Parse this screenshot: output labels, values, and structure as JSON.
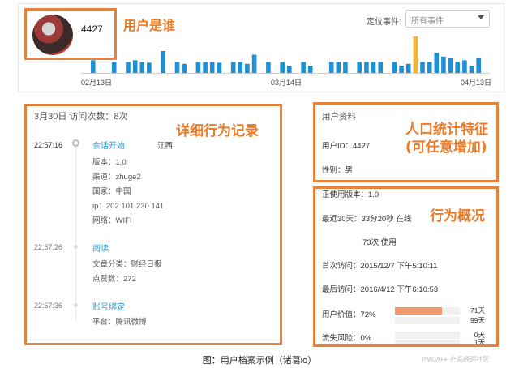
{
  "header": {
    "user_id": "4427",
    "filter_label": "定位事件:",
    "filter_value": "所有事件"
  },
  "timeline": {
    "dates": [
      "02月13日",
      "03月14日",
      "04月13日"
    ],
    "values": [
      0.35,
      0,
      0,
      0.3,
      0,
      0.3,
      0.35,
      0.3,
      0.28,
      0,
      0.6,
      0,
      0.3,
      0.25,
      0,
      0.3,
      0.3,
      0.3,
      0.28,
      0,
      0.3,
      0.3,
      0.25,
      0.5,
      0,
      0.3,
      0,
      0.3,
      0.2,
      0,
      0.3,
      0.2,
      0,
      0,
      0.3,
      0.3,
      0.3,
      0,
      0.3,
      0.3,
      0.3,
      0.3,
      0,
      0.3,
      0.2,
      0.25,
      1.0,
      0.3,
      0.3,
      0.55,
      0.45,
      0.4,
      0.3,
      0.35,
      0.2,
      0.4
    ],
    "colors": {
      "default": "#1e90d6",
      "highlight": "#f2b43a"
    },
    "highlight_index": 46
  },
  "detail": {
    "header": "3月30日  访问次数：8次",
    "events": [
      {
        "time": "22:57:16",
        "title": "会话开始",
        "extra": "江西",
        "lines": [
          "版本：1.0",
          "渠道：zhuge2",
          "国家：中国",
          "ip：202.101.230.141",
          "网络：WIFI"
        ]
      },
      {
        "time": "22:57:26",
        "title": "阅读",
        "lines": [
          "文章分类：财经日报",
          "点赞数：272"
        ]
      },
      {
        "time": "22:57:36",
        "title": "账号绑定",
        "lines": [
          "平台：腾讯微博"
        ]
      }
    ]
  },
  "profile": {
    "title": "用户资料",
    "user_id_line": "用户ID：4427",
    "gender_line": "性别：男"
  },
  "overview": {
    "version": "正使用版本：1.0",
    "last30": "最近30天：33分20秒 在线",
    "uses": "73次 使用",
    "first_visit": "首次访问：2015/12/7 下午5:10:11",
    "last_visit": "最后访问：2016/4/12 下午6:10:53",
    "value_label": "用户价值：72%",
    "value_pct": 72,
    "value_nums": [
      "71天",
      "99天"
    ],
    "churn_label": "流失风险：0%",
    "churn_pct": 0,
    "churn_nums": [
      "0天",
      "1天"
    ]
  },
  "annotations": {
    "who": "用户是谁",
    "records": "详细行为记录",
    "demographics_1": "人口统计特征",
    "demographics_2": "(可任意增加)",
    "behavior": "行为概况"
  },
  "caption": "图：用户档案示例（诸葛io）",
  "watermark": "PMCAFF 产品经理社区"
}
